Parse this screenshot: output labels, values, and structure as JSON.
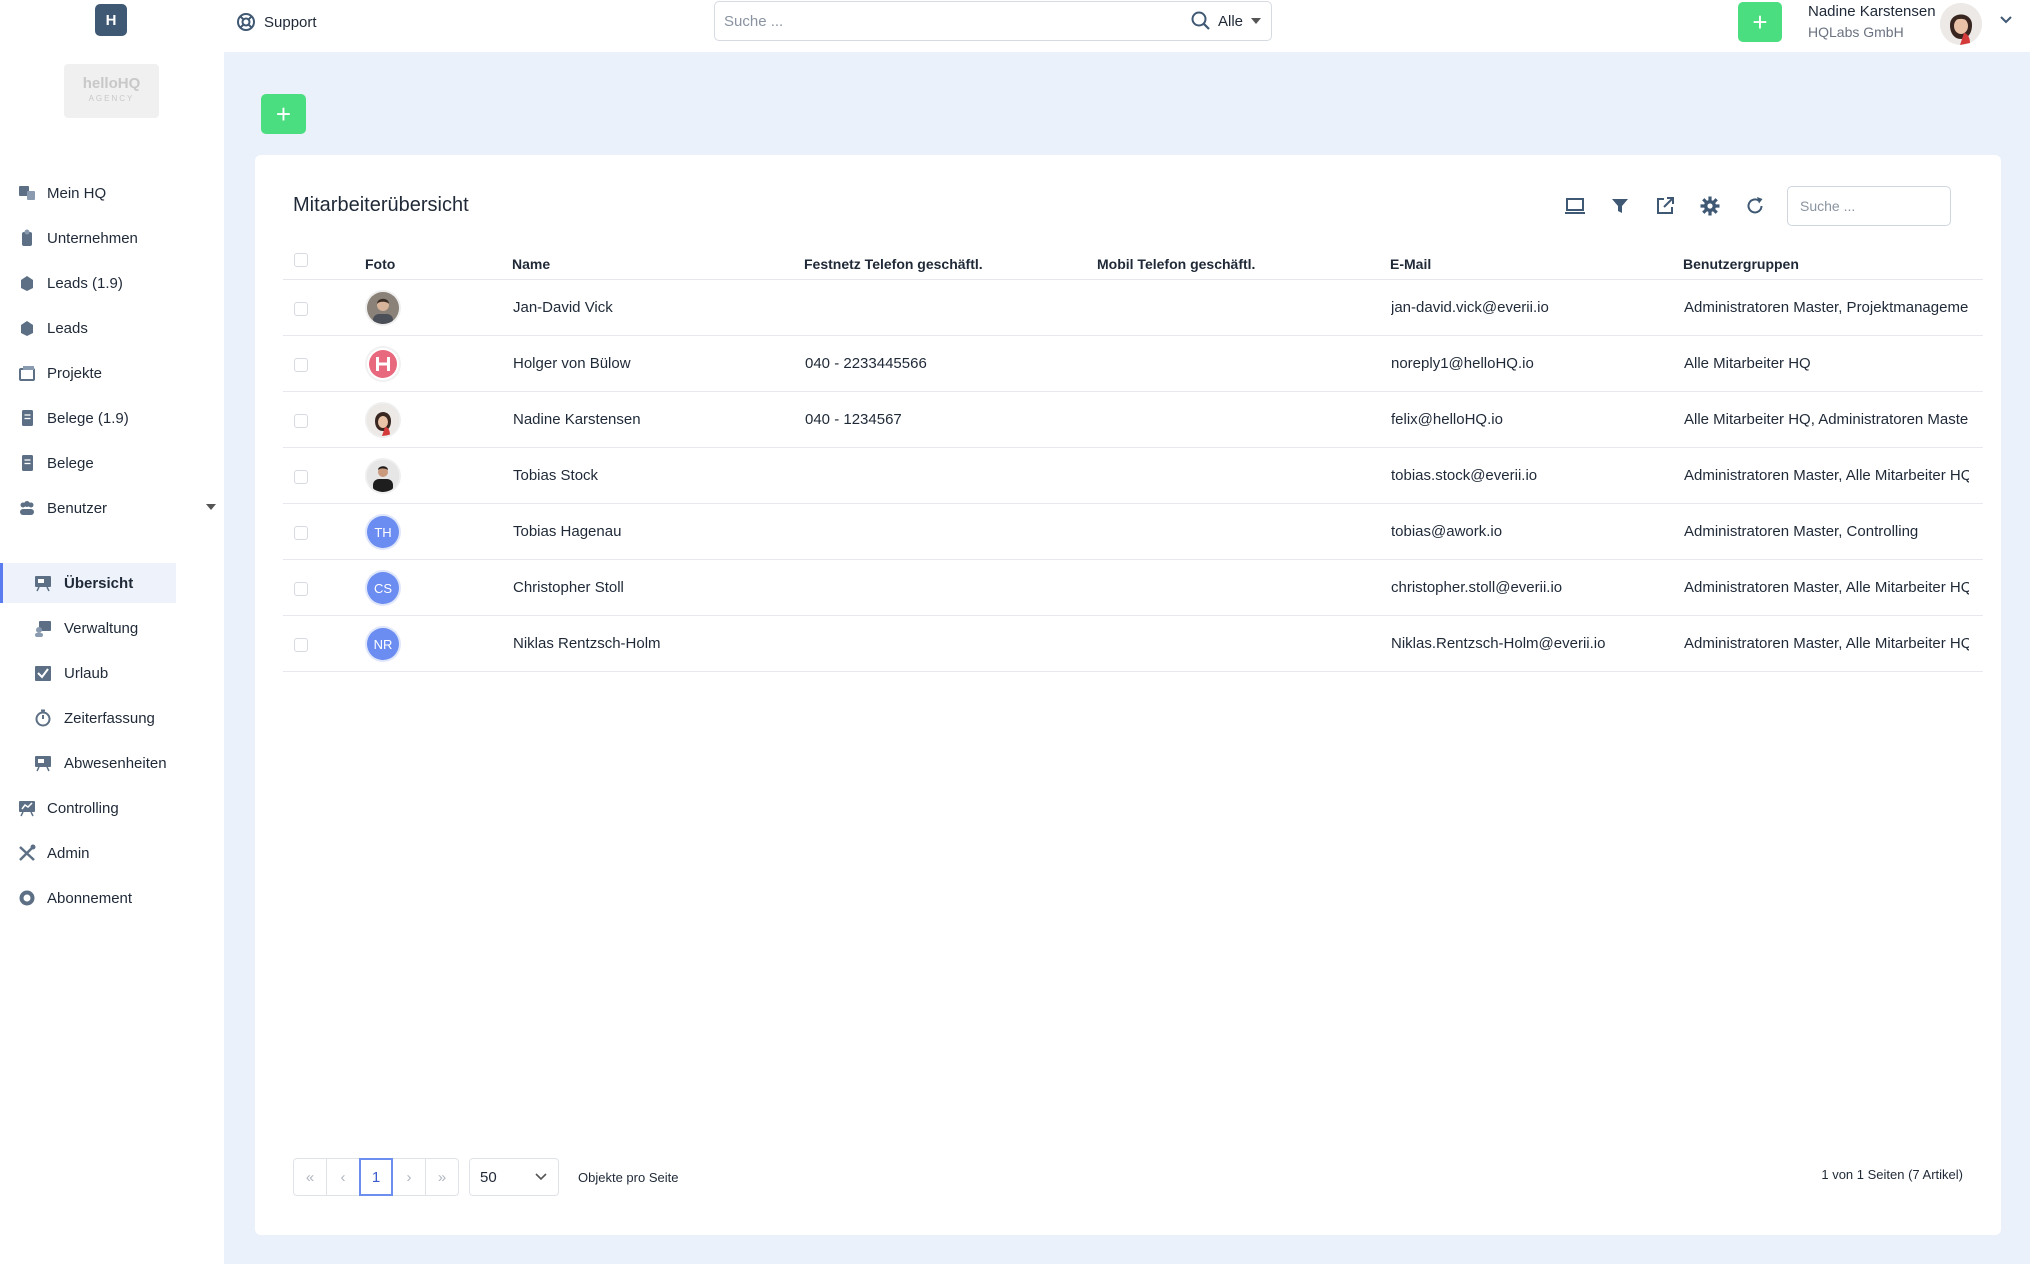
{
  "header": {
    "logo_text": "H",
    "support_label": "Support",
    "search": {
      "placeholder": "Suche ...",
      "scope": "Alle"
    },
    "user": {
      "name": "Nadine Karstensen",
      "company": "HQLabs GmbH"
    }
  },
  "brand": {
    "name": "helloHQ",
    "tagline": "AGENCY"
  },
  "sidebar": {
    "items": [
      {
        "label": "Mein HQ",
        "icon": "dashboard-icon"
      },
      {
        "label": "Unternehmen",
        "icon": "building-icon"
      },
      {
        "label": "Leads (1.9)",
        "icon": "handshake-icon"
      },
      {
        "label": "Leads",
        "icon": "handshake-icon"
      },
      {
        "label": "Projekte",
        "icon": "folder-icon"
      },
      {
        "label": "Belege (1.9)",
        "icon": "document-icon"
      },
      {
        "label": "Belege",
        "icon": "document-icon"
      },
      {
        "label": "Benutzer",
        "icon": "users-icon"
      },
      {
        "label": "Übersicht",
        "icon": "presentation-icon"
      },
      {
        "label": "Verwaltung",
        "icon": "user-settings-icon"
      },
      {
        "label": "Urlaub",
        "icon": "calendar-check-icon"
      },
      {
        "label": "Zeiterfassung",
        "icon": "stopwatch-icon"
      },
      {
        "label": "Abwesenheiten",
        "icon": "presentation-icon"
      },
      {
        "label": "Controlling",
        "icon": "chart-board-icon"
      },
      {
        "label": "Admin",
        "icon": "tools-icon"
      },
      {
        "label": "Abonnement",
        "icon": "circle-icon"
      }
    ]
  },
  "main": {
    "card": {
      "title": "Mitarbeiterübersicht",
      "search_placeholder": "Suche ..."
    },
    "table": {
      "columns": [
        "Foto",
        "Name",
        "Festnetz Telefon geschäftl.",
        "Mobil Telefon geschäftl.",
        "E-Mail",
        "Benutzergruppen"
      ],
      "rows": [
        {
          "avatar": "",
          "name": "Jan-David Vick",
          "phone": "",
          "mobile": "",
          "email": "jan-david.vick@everii.io",
          "groups": "Administratoren Master, Projektmanagemer"
        },
        {
          "avatar": "",
          "name": "Holger von Bülow",
          "phone": "040 - 2233445566",
          "mobile": "",
          "email": "noreply1@helloHQ.io",
          "groups": "Alle Mitarbeiter HQ"
        },
        {
          "avatar": "",
          "name": "Nadine Karstensen",
          "phone": "040 - 1234567",
          "mobile": "",
          "email": "felix@helloHQ.io",
          "groups": "Alle Mitarbeiter HQ, Administratoren Master"
        },
        {
          "avatar": "",
          "name": "Tobias Stock",
          "phone": "",
          "mobile": "",
          "email": "tobias.stock@everii.io",
          "groups": "Administratoren Master, Alle Mitarbeiter HQ"
        },
        {
          "avatar": "TH",
          "name": "Tobias Hagenau",
          "phone": "",
          "mobile": "",
          "email": "tobias@awork.io",
          "groups": "Administratoren Master, Controlling"
        },
        {
          "avatar": "CS",
          "name": "Christopher Stoll",
          "phone": "",
          "mobile": "",
          "email": "christopher.stoll@everii.io",
          "groups": "Administratoren Master, Alle Mitarbeiter HQ"
        },
        {
          "avatar": "NR",
          "name": "Niklas Rentzsch-Holm",
          "phone": "",
          "mobile": "",
          "email": "Niklas.Rentzsch-Holm@everii.io",
          "groups": "Administratoren Master, Alle Mitarbeiter HQ"
        }
      ]
    },
    "pagination": {
      "first": "«",
      "prev": "‹",
      "current": "1",
      "next": "›",
      "last": "»",
      "per_page": "50",
      "per_page_label": "Objekte pro Seite",
      "info": "1 von 1 Seiten (7 Artikel)"
    }
  },
  "colors": {
    "accent_green": "#4ade80",
    "accent_blue": "#5b7cf0",
    "main_bg": "#eaf1fb"
  }
}
